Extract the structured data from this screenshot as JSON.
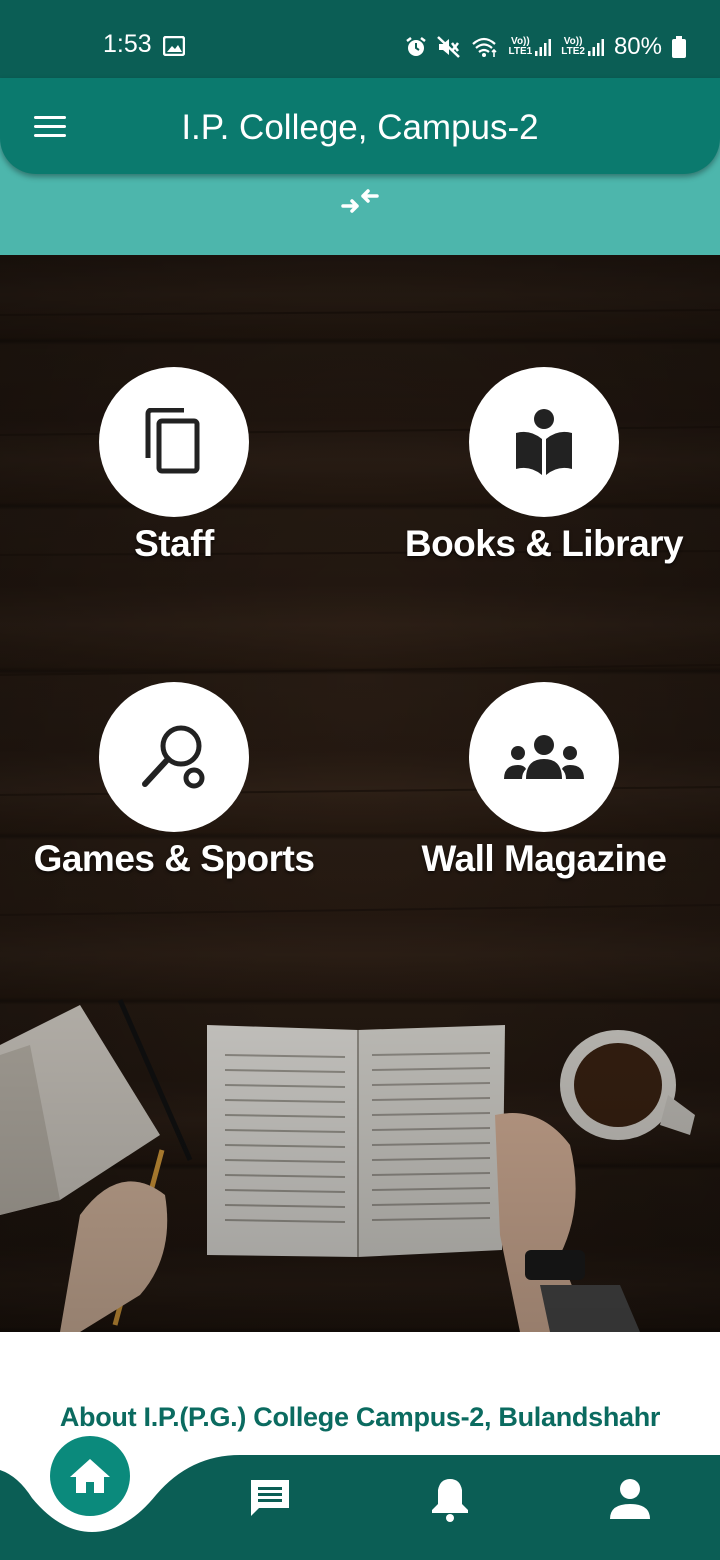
{
  "status_bar": {
    "time": "1:53",
    "lte1": [
      "Vo))",
      "LTE1"
    ],
    "lte2": [
      "Vo))",
      "LTE2"
    ],
    "battery": "80%"
  },
  "app_bar": {
    "title": "I.P. College, Campus-2",
    "menu_icon": "menu-icon",
    "collapse_icon": "collapse-arrows-icon"
  },
  "tiles": [
    {
      "label": "Staff",
      "icon": "copy-icon"
    },
    {
      "label": "Books & Library",
      "icon": "book-reader-icon"
    },
    {
      "label": "Games & Sports",
      "icon": "racket-ball-icon"
    },
    {
      "label": "Wall Magazine",
      "icon": "group-icon"
    }
  ],
  "about": {
    "title": "About I.P.(P.G.) College Campus-2, Bulandshahr"
  },
  "bottom_nav": {
    "items": [
      "home-icon",
      "chat-icon",
      "bell-icon",
      "profile-icon"
    ]
  },
  "colors": {
    "primary": "#0b7a6e",
    "primary_dark": "#0b5e55",
    "accent_band": "#4db6ac",
    "about_text": "#0b6b60"
  }
}
